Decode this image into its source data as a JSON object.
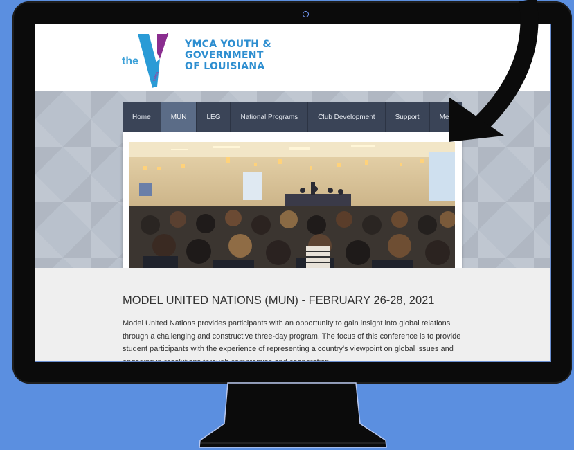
{
  "brand": {
    "the": "the",
    "name_lines": [
      "YMCA YOUTH &",
      "GOVERNMENT",
      "OF LOUISIANA"
    ],
    "mark_text": "YMCA",
    "colors": {
      "y_blue": "#2a9bd6",
      "y_purple": "#8a2d8f",
      "y_magenta": "#c0268b"
    }
  },
  "nav": {
    "items": [
      {
        "label": "Home",
        "active": false
      },
      {
        "label": "MUN",
        "active": true
      },
      {
        "label": "LEG",
        "active": false
      },
      {
        "label": "National Programs",
        "active": false
      },
      {
        "label": "Club Development",
        "active": false
      },
      {
        "label": "Support",
        "active": false
      },
      {
        "label": "Media",
        "active": false
      }
    ]
  },
  "hero": {
    "image": "conference-hall-photo"
  },
  "article": {
    "title": "MODEL UNITED NATIONS (MUN) - FEBRUARY 26-28, 2021",
    "body_lines": [
      "Model United Nations provides participants with an opportunity to gain insight into global relations",
      "through a challenging and constructive three-day program. The focus of this conference is to provide",
      "student participants with the experience of representing a country's viewpoint on global issues and",
      "engaging in resolutions through compromise and cooperation."
    ]
  },
  "colors": {
    "background": "#5b8fe0",
    "monitor": "#0b0b0b",
    "nav_bg": "#3a4457",
    "nav_active": "#5b6c87"
  }
}
